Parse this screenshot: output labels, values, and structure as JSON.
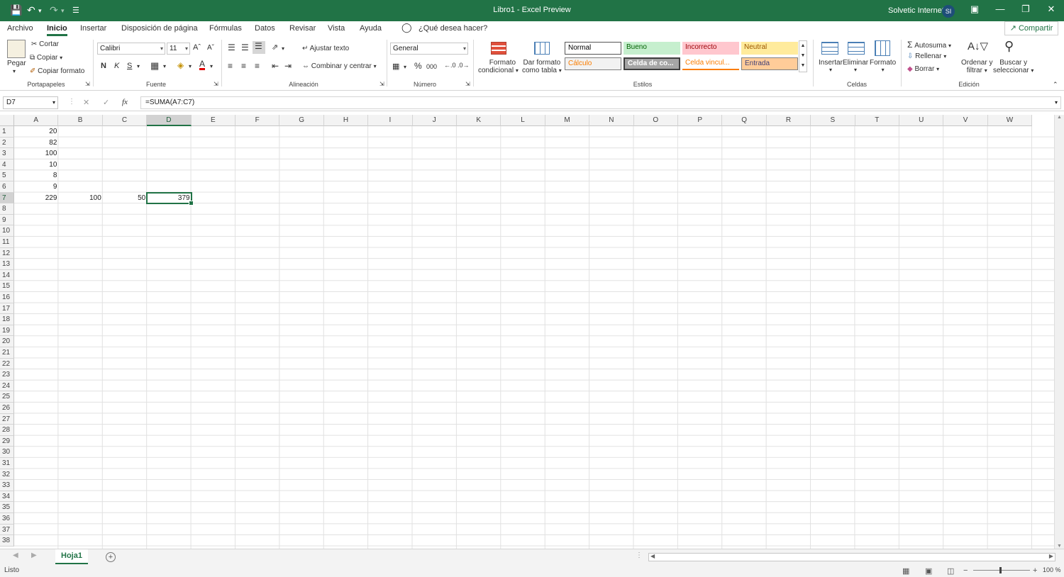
{
  "window": {
    "title": "Libro1  -  Excel Preview",
    "user": "Solvetic Internet",
    "avatar_initials": "SI"
  },
  "menu": {
    "tabs": [
      "Archivo",
      "Inicio",
      "Insertar",
      "Disposición de página",
      "Fórmulas",
      "Datos",
      "Revisar",
      "Vista",
      "Ayuda"
    ],
    "search_placeholder": "¿Qué desea hacer?",
    "share_label": "Compartir"
  },
  "ribbon": {
    "clipboard": {
      "paste": "Pegar",
      "cut": "Cortar",
      "copy": "Copiar",
      "format_painter": "Copiar formato",
      "label": "Portapapeles"
    },
    "font": {
      "family": "Calibri",
      "size": "11",
      "bold": "N",
      "italic": "K",
      "underline": "S",
      "label": "Fuente"
    },
    "alignment": {
      "wrap": "Ajustar texto",
      "merge": "Combinar y centrar",
      "label": "Alineación"
    },
    "number": {
      "format": "General",
      "label": "Número"
    },
    "styles": {
      "conditional": [
        "Formato",
        "condicional"
      ],
      "as_table": [
        "Dar formato",
        "como tabla"
      ],
      "cells": [
        {
          "text": "Normal",
          "bg": "#ffffff",
          "fg": "#000000"
        },
        {
          "text": "Bueno",
          "bg": "#c6efce",
          "fg": "#006100"
        },
        {
          "text": "Incorrecto",
          "bg": "#ffc7ce",
          "fg": "#9c0006"
        },
        {
          "text": "Neutral",
          "bg": "#ffeb9c",
          "fg": "#9c5700"
        },
        {
          "text": "Cálculo",
          "bg": "#f2f2f2",
          "fg": "#fa7d00"
        },
        {
          "text": "Celda de co...",
          "bg": "#a5a5a5",
          "fg": "#ffffff"
        },
        {
          "text": "Celda vincul...",
          "bg": "#ffffff",
          "fg": "#fa7d00"
        },
        {
          "text": "Entrada",
          "bg": "#ffcc99",
          "fg": "#3f3f76"
        }
      ],
      "label": "Estilos"
    },
    "cells_group": {
      "insert": "Insertar",
      "delete": "Eliminar",
      "format": "Formato",
      "label": "Celdas"
    },
    "editing": {
      "autosum": "Autosuma",
      "fill": "Rellenar",
      "clear": "Borrar",
      "sort": [
        "Ordenar y",
        "filtrar"
      ],
      "find": [
        "Buscar y",
        "seleccionar"
      ],
      "label": "Edición"
    }
  },
  "formula_bar": {
    "name_box": "D7",
    "fx": "fx",
    "formula": "=SUMA(A7:C7)"
  },
  "sheet": {
    "columns": [
      "A",
      "B",
      "C",
      "D",
      "E",
      "F",
      "G",
      "H",
      "I",
      "J",
      "K",
      "L",
      "M",
      "N",
      "O",
      "P",
      "Q",
      "R",
      "S",
      "T",
      "U",
      "V",
      "W"
    ],
    "row_count": 38,
    "selected_cell": "D7",
    "cells": [
      {
        "ref": "A1",
        "value": "20"
      },
      {
        "ref": "A2",
        "value": "82"
      },
      {
        "ref": "A3",
        "value": "100"
      },
      {
        "ref": "A4",
        "value": "10"
      },
      {
        "ref": "A5",
        "value": "8"
      },
      {
        "ref": "A6",
        "value": "9"
      },
      {
        "ref": "A7",
        "value": "229"
      },
      {
        "ref": "B7",
        "value": "100"
      },
      {
        "ref": "C7",
        "value": "50"
      },
      {
        "ref": "D7",
        "value": "379"
      }
    ],
    "tab_name": "Hoja1"
  },
  "status": {
    "text": "Listo",
    "zoom": "100 %"
  },
  "colors": {
    "accent": "#217346"
  }
}
